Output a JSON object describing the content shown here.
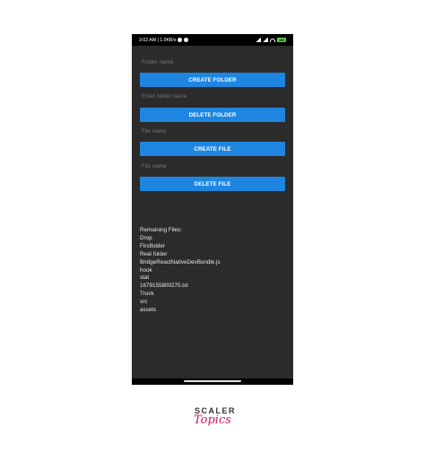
{
  "status_bar": {
    "time_speed": "3:02 AM | 1.0KB/s",
    "battery": "100"
  },
  "form": {
    "folder_create_placeholder": "Folder name",
    "create_folder_label": "CREATE FOLDER",
    "folder_delete_placeholder": "Enter folder name",
    "delete_folder_label": "DELETE FOLDER",
    "file_create_placeholder": "File name",
    "create_file_label": "CREATE FILE",
    "file_delete_placeholder": "File name",
    "delete_file_label": "DELETE FILE"
  },
  "files": {
    "heading": "Remaining Files:",
    "items": [
      "Drop",
      "Firstfolder",
      "Real folder",
      "BridgeReactNativeDevBundle.js",
      "hook",
      "stat",
      "1679155800275.txt",
      "Truck",
      "src",
      "assets"
    ]
  },
  "branding": {
    "brand_top": "SCALER",
    "brand_bottom": "Topics",
    "accent_color": "#c2196b"
  },
  "colors": {
    "button": "#1e86e0",
    "app_background": "#2b2b2b",
    "status_bar": "#000000"
  }
}
